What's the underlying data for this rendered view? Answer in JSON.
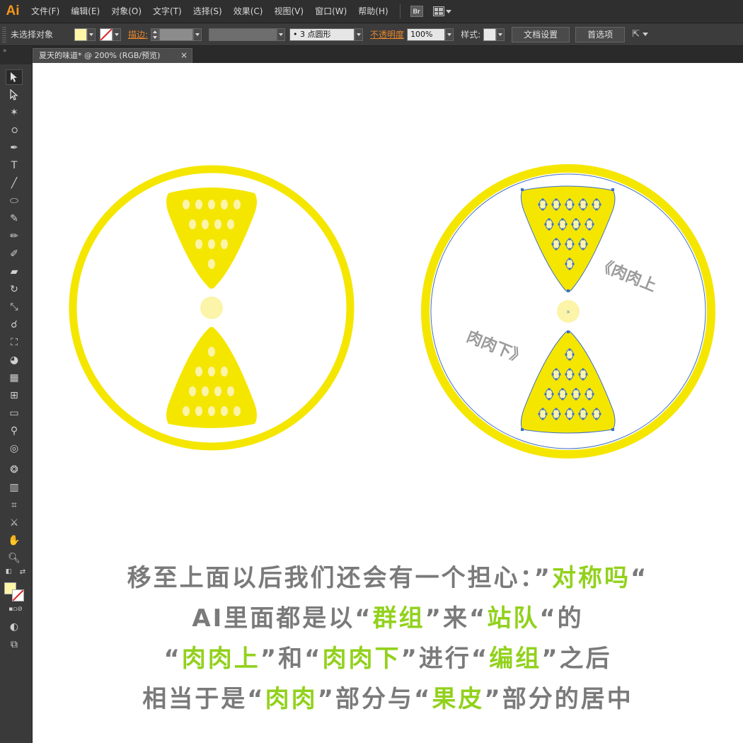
{
  "app": {
    "logo": "Ai",
    "menu": [
      "文件(F)",
      "编辑(E)",
      "对象(O)",
      "文字(T)",
      "选择(S)",
      "效果(C)",
      "视图(V)",
      "窗口(W)",
      "帮助(H)"
    ],
    "bridge_label": "Br"
  },
  "control": {
    "selection_label": "未选择对象",
    "stroke_link": "描边:",
    "brush_value": "3 点圆形",
    "opacity_link": "不透明度",
    "opacity_value": "100%",
    "style_label": "样式:",
    "doc_settings": "文档设置",
    "preferences": "首选项",
    "colors": {
      "fill": "#fff6a8",
      "stroke": "none"
    }
  },
  "document": {
    "tab_title": "夏天的味道* @ 200% (RGB/预览)",
    "tab_close": "×"
  },
  "tools_header": "»",
  "artwork": {
    "colors": {
      "yellow": "#f5e600",
      "pale_yellow": "#fbf4a9",
      "selection_blue": "#3d6fc4",
      "label_gray": "#9a9a9a"
    },
    "label_top": "《肉肉上",
    "label_bottom": "肉肉下》"
  },
  "caption": {
    "line1": [
      "移至上面以后我们还会有一个担心：”",
      "对称吗",
      "“"
    ],
    "line2": [
      "AI里面都是以“",
      "群组",
      "”来“",
      "站队",
      "“的"
    ],
    "line3": [
      "“",
      "肉肉上",
      "”和“",
      "肉肉下",
      "”进行“",
      "编组",
      "”之后"
    ],
    "line4": [
      "相当于是“",
      "肉肉",
      "”部分与“",
      "果皮",
      "”部分的居中"
    ],
    "colors": {
      "gray": "#7a7a7a",
      "green": "#92d11c"
    }
  }
}
